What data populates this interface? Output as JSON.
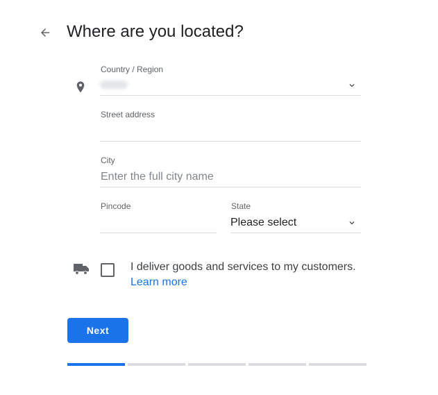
{
  "header": {
    "title": "Where are you located?",
    "back_icon": "arrow-left-icon"
  },
  "form": {
    "country": {
      "label": "Country / Region",
      "value": "",
      "value_blurred": true,
      "icon": "location-pin-icon"
    },
    "street": {
      "label": "Street address",
      "value": ""
    },
    "city": {
      "label": "City",
      "placeholder": "Enter the full city name"
    },
    "pincode": {
      "label": "Pincode",
      "value": ""
    },
    "state": {
      "label": "State",
      "value": "Please select"
    }
  },
  "delivery": {
    "icon": "truck-icon",
    "checked": false,
    "text": "I deliver goods and services to my customers.",
    "link": "Learn more"
  },
  "actions": {
    "next_label": "Next"
  },
  "progress": {
    "total_steps": 5,
    "current_step": 1
  },
  "colors": {
    "accent": "#1a73e8",
    "divider": "#dadce0",
    "label": "#5f6368"
  }
}
